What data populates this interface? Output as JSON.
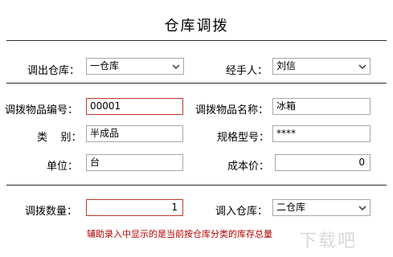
{
  "title": "仓库调拨",
  "row1": {
    "out_label": "调出仓库：",
    "out_value": "一仓库",
    "handler_label": "经手人：",
    "handler_value": "刘信"
  },
  "row2": {
    "code_label": "调拨物品编号：",
    "code_value": "00001",
    "name_label": "调拨物品名称：",
    "name_value": "冰箱"
  },
  "row3": {
    "cat_label": "类    别：",
    "cat_value": "半成品",
    "spec_label": "规格型号：",
    "spec_value": "****"
  },
  "row4": {
    "unit_label": "单位：",
    "unit_value": "台",
    "cost_label": "成本价：",
    "cost_value": "0"
  },
  "row5": {
    "qty_label": "调拨数量：",
    "qty_value": "1",
    "in_label": "调入仓库：",
    "in_value": "二仓库"
  },
  "note": "辅助录入中显示的是当前按仓库分类的库存总量",
  "watermark": "下载吧",
  "icons": {
    "dropdown": "chevron-down-icon"
  }
}
